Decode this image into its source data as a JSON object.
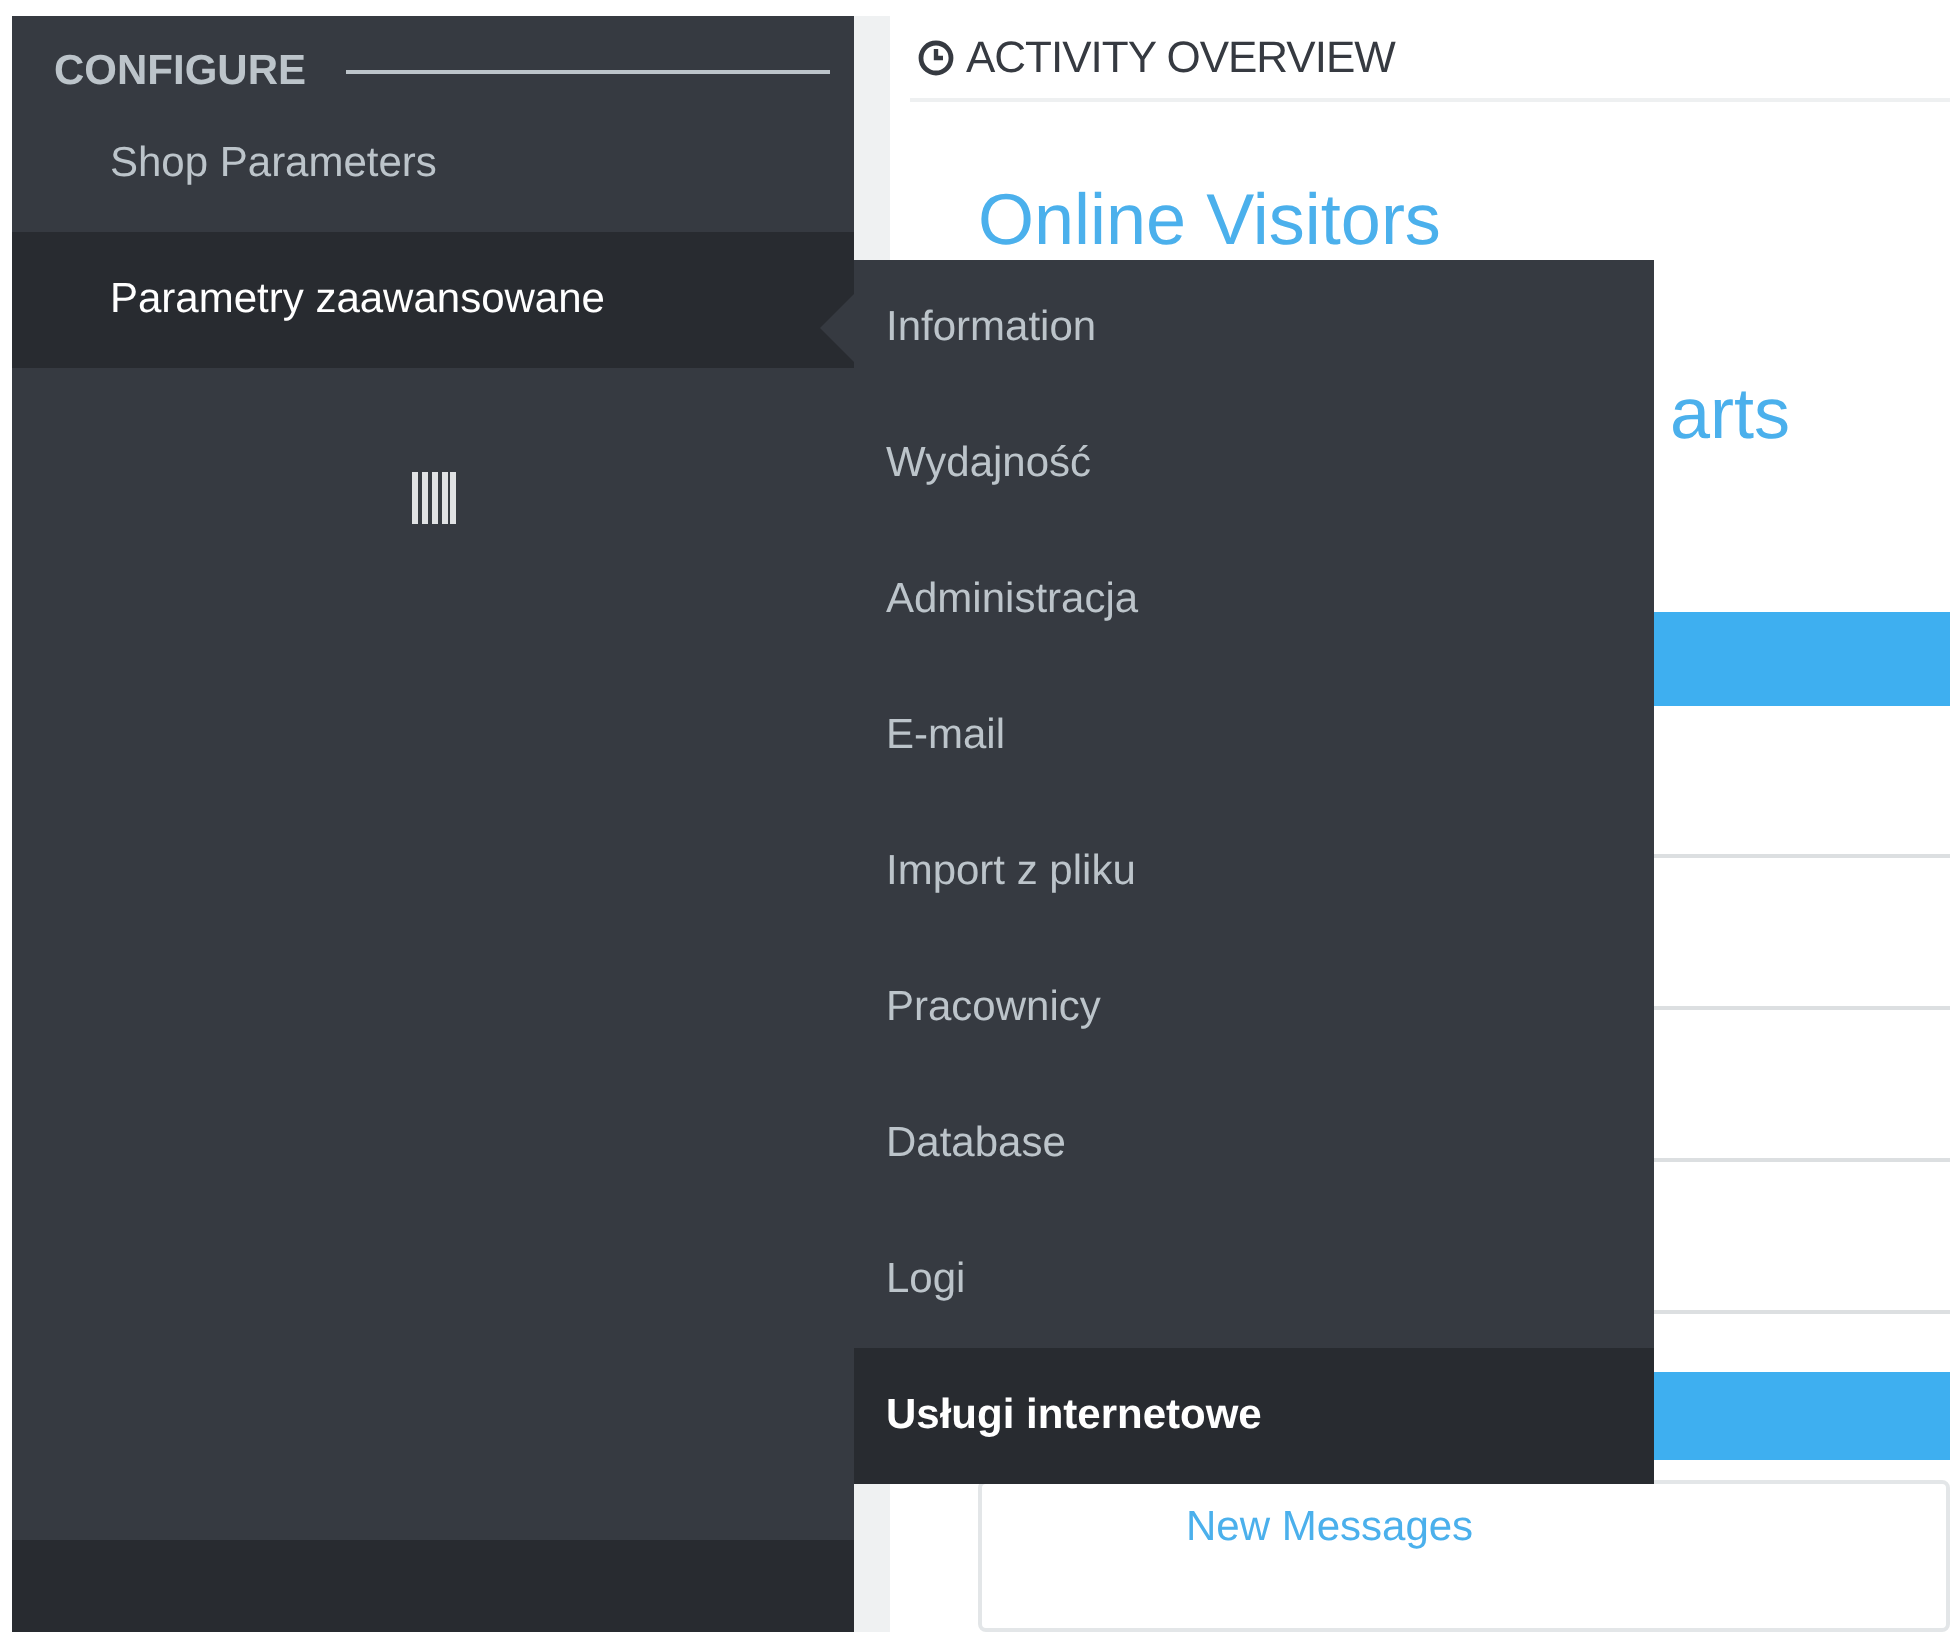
{
  "sidebar": {
    "section_title": "CONFIGURE",
    "items": [
      {
        "label": "Shop Parameters",
        "selected": false
      },
      {
        "label": "Parametry zaawansowane",
        "selected": true
      }
    ]
  },
  "submenu": {
    "items": [
      {
        "label": "Information",
        "selected": false
      },
      {
        "label": "Wydajność",
        "selected": false
      },
      {
        "label": "Administracja",
        "selected": false
      },
      {
        "label": "E-mail",
        "selected": false
      },
      {
        "label": "Import z pliku",
        "selected": false
      },
      {
        "label": "Pracownicy",
        "selected": false
      },
      {
        "label": "Database",
        "selected": false
      },
      {
        "label": "Logi",
        "selected": false
      },
      {
        "label": "Usługi internetowe",
        "selected": true
      }
    ]
  },
  "content": {
    "section_title": "ACTIVITY OVERVIEW",
    "headings": [
      "Online Visitors",
      "arts"
    ],
    "card_link": "New Messages"
  }
}
